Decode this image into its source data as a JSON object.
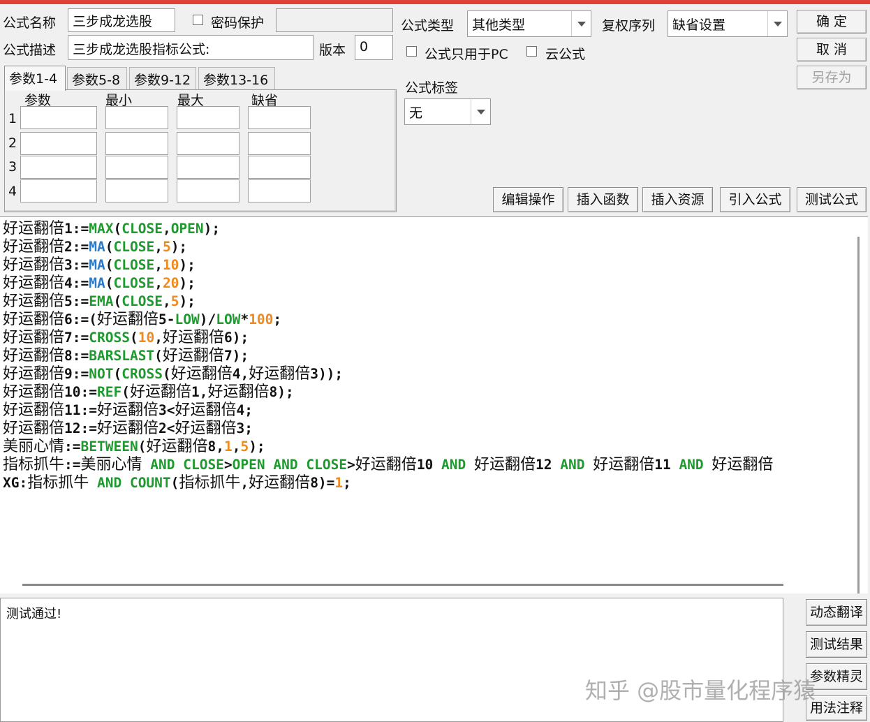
{
  "header": {
    "name_label": "公式名称",
    "name_value": "三步成龙选股",
    "password_label": "密码保护",
    "desc_label": "公式描述",
    "desc_value": "三步成龙选股指标公式:",
    "version_label": "版本",
    "version_value": "0",
    "type_label": "公式类型",
    "type_value": "其他类型",
    "rights_label": "复权序列",
    "rights_value": "缺省设置",
    "pc_only_label": "公式只用于PC",
    "cloud_label": "云公式",
    "tag_label": "公式标签",
    "tag_value": "无"
  },
  "buttons": {
    "ok": "确  定",
    "cancel": "取  消",
    "save_as": "另存为",
    "edit_ops": "编辑操作",
    "insert_func": "插入函数",
    "insert_res": "插入资源",
    "import_formula": "引入公式",
    "test_formula": "测试公式",
    "dynamic_translate": "动态翻译",
    "test_result": "测试结果",
    "param_wizard": "参数精灵",
    "usage_notes": "用法注释"
  },
  "params": {
    "tabs": [
      "参数1-4",
      "参数5-8",
      "参数9-12",
      "参数13-16"
    ],
    "columns": [
      "参数",
      "最小",
      "最大",
      "缺省"
    ],
    "rows": [
      "1",
      "2",
      "3",
      "4"
    ]
  },
  "code_lines": [
    [
      [
        "好运翻倍",
        "cn"
      ],
      [
        "1:=",
        "v"
      ],
      [
        "MAX",
        "f"
      ],
      [
        "(",
        "v"
      ],
      [
        "CLOSE",
        "f"
      ],
      [
        ",",
        "v"
      ],
      [
        "OPEN",
        "f"
      ],
      [
        ");",
        "v"
      ]
    ],
    [
      [
        "好运翻倍",
        "cn"
      ],
      [
        "2:=",
        "v"
      ],
      [
        "MA",
        "b"
      ],
      [
        "(",
        "v"
      ],
      [
        "CLOSE",
        "f"
      ],
      [
        ",",
        "v"
      ],
      [
        "5",
        "n"
      ],
      [
        ");",
        "v"
      ]
    ],
    [
      [
        "好运翻倍",
        "cn"
      ],
      [
        "3:=",
        "v"
      ],
      [
        "MA",
        "b"
      ],
      [
        "(",
        "v"
      ],
      [
        "CLOSE",
        "f"
      ],
      [
        ",",
        "v"
      ],
      [
        "10",
        "n"
      ],
      [
        ");",
        "v"
      ]
    ],
    [
      [
        "好运翻倍",
        "cn"
      ],
      [
        "4:=",
        "v"
      ],
      [
        "MA",
        "b"
      ],
      [
        "(",
        "v"
      ],
      [
        "CLOSE",
        "f"
      ],
      [
        ",",
        "v"
      ],
      [
        "20",
        "n"
      ],
      [
        ");",
        "v"
      ]
    ],
    [
      [
        "好运翻倍",
        "cn"
      ],
      [
        "5:=",
        "v"
      ],
      [
        "EMA",
        "f"
      ],
      [
        "(",
        "v"
      ],
      [
        "CLOSE",
        "f"
      ],
      [
        ",",
        "v"
      ],
      [
        "5",
        "n"
      ],
      [
        ");",
        "v"
      ]
    ],
    [
      [
        "好运翻倍",
        "cn"
      ],
      [
        "6:=(",
        "v"
      ],
      [
        "好运翻倍",
        "cn"
      ],
      [
        "5-",
        "v"
      ],
      [
        "LOW",
        "f"
      ],
      [
        ")/",
        "v"
      ],
      [
        "LOW",
        "f"
      ],
      [
        "*",
        "v"
      ],
      [
        "100",
        "n"
      ],
      [
        ";",
        "v"
      ]
    ],
    [
      [
        "好运翻倍",
        "cn"
      ],
      [
        "7:=",
        "v"
      ],
      [
        "CROSS",
        "f"
      ],
      [
        "(",
        "v"
      ],
      [
        "10",
        "n"
      ],
      [
        ",",
        "v"
      ],
      [
        "好运翻倍",
        "cn"
      ],
      [
        "6);",
        "v"
      ]
    ],
    [
      [
        "好运翻倍",
        "cn"
      ],
      [
        "8:=",
        "v"
      ],
      [
        "BARSLAST",
        "f"
      ],
      [
        "(",
        "v"
      ],
      [
        "好运翻倍",
        "cn"
      ],
      [
        "7);",
        "v"
      ]
    ],
    [
      [
        "好运翻倍",
        "cn"
      ],
      [
        "9:=",
        "v"
      ],
      [
        "NOT",
        "f"
      ],
      [
        "(",
        "v"
      ],
      [
        "CROSS",
        "f"
      ],
      [
        "(",
        "v"
      ],
      [
        "好运翻倍",
        "cn"
      ],
      [
        "4,",
        "v"
      ],
      [
        "好运翻倍",
        "cn"
      ],
      [
        "3));",
        "v"
      ]
    ],
    [
      [
        "好运翻倍",
        "cn"
      ],
      [
        "10:=",
        "v"
      ],
      [
        "REF",
        "f"
      ],
      [
        "(",
        "v"
      ],
      [
        "好运翻倍",
        "cn"
      ],
      [
        "1,",
        "v"
      ],
      [
        "好运翻倍",
        "cn"
      ],
      [
        "8);",
        "v"
      ]
    ],
    [
      [
        "好运翻倍",
        "cn"
      ],
      [
        "11:=",
        "v"
      ],
      [
        "好运翻倍",
        "cn"
      ],
      [
        "3<",
        "v"
      ],
      [
        "好运翻倍",
        "cn"
      ],
      [
        "4;",
        "v"
      ]
    ],
    [
      [
        "好运翻倍",
        "cn"
      ],
      [
        "12:=",
        "v"
      ],
      [
        "好运翻倍",
        "cn"
      ],
      [
        "2<",
        "v"
      ],
      [
        "好运翻倍",
        "cn"
      ],
      [
        "3;",
        "v"
      ]
    ],
    [
      [
        "美丽心情",
        "cn"
      ],
      [
        ":=",
        "v"
      ],
      [
        "BETWEEN",
        "f"
      ],
      [
        "(",
        "v"
      ],
      [
        "好运翻倍",
        "cn"
      ],
      [
        "8,",
        "v"
      ],
      [
        "1",
        "n"
      ],
      [
        ",",
        "v"
      ],
      [
        "5",
        "n"
      ],
      [
        ");",
        "v"
      ]
    ],
    [
      [
        "指标抓牛",
        "cn"
      ],
      [
        ":=",
        "v"
      ],
      [
        "美丽心情",
        "cn"
      ],
      [
        " AND ",
        "f"
      ],
      [
        "CLOSE",
        "f"
      ],
      [
        ">",
        "v"
      ],
      [
        "OPEN",
        "f"
      ],
      [
        " AND ",
        "f"
      ],
      [
        "CLOSE",
        "f"
      ],
      [
        ">",
        "v"
      ],
      [
        "好运翻倍",
        "cn"
      ],
      [
        "10",
        "v"
      ],
      [
        " AND ",
        "f"
      ],
      [
        "好运翻倍",
        "cn"
      ],
      [
        "12",
        "v"
      ],
      [
        " AND ",
        "f"
      ],
      [
        "好运翻倍",
        "cn"
      ],
      [
        "11",
        "v"
      ],
      [
        " AND ",
        "f"
      ],
      [
        "好运翻倍",
        "cn"
      ]
    ],
    [
      [
        "XG:",
        "v"
      ],
      [
        "指标抓牛",
        "cn"
      ],
      [
        " AND ",
        "f"
      ],
      [
        "COUNT",
        "f"
      ],
      [
        "(",
        "v"
      ],
      [
        "指标抓牛",
        "cn"
      ],
      [
        ",",
        "v"
      ],
      [
        "好运翻倍",
        "cn"
      ],
      [
        "8)=",
        "v"
      ],
      [
        "1",
        "n"
      ],
      [
        ";",
        "v"
      ]
    ]
  ],
  "output_text": "测试通过!",
  "watermark": "知乎 @股市量化程序猿"
}
